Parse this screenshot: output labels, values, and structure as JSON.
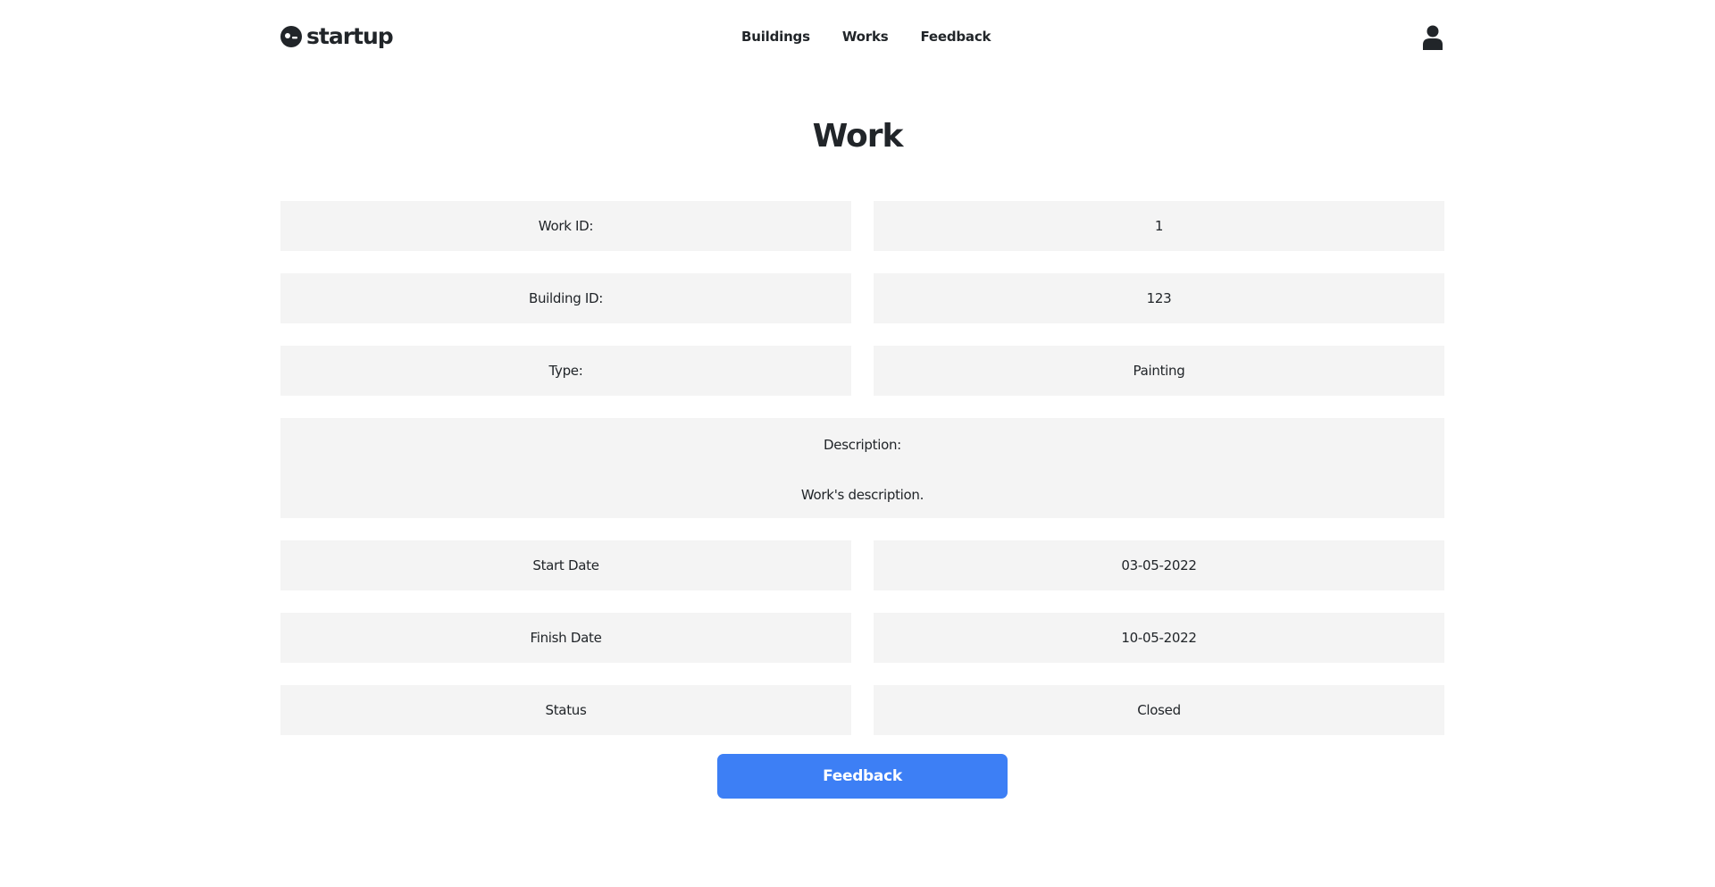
{
  "header": {
    "brand_name": "startup",
    "nav": [
      {
        "label": "Buildings"
      },
      {
        "label": "Works"
      },
      {
        "label": "Feedback"
      }
    ]
  },
  "page": {
    "title": "Work"
  },
  "details": {
    "work_id": {
      "label": "Work ID:",
      "value": "1"
    },
    "building_id": {
      "label": "Building ID:",
      "value": "123"
    },
    "type": {
      "label": "Type:",
      "value": "Painting"
    },
    "description": {
      "label": "Description:",
      "value": "Work's description."
    },
    "start_date": {
      "label": "Start Date",
      "value": "03-05-2022"
    },
    "finish_date": {
      "label": "Finish Date",
      "value": "10-05-2022"
    },
    "status": {
      "label": "Status",
      "value": "Closed"
    }
  },
  "actions": {
    "feedback_button": "Feedback"
  },
  "colors": {
    "accent": "#3d7ff5",
    "cell_background": "#f4f4f4",
    "text": "#212529"
  }
}
